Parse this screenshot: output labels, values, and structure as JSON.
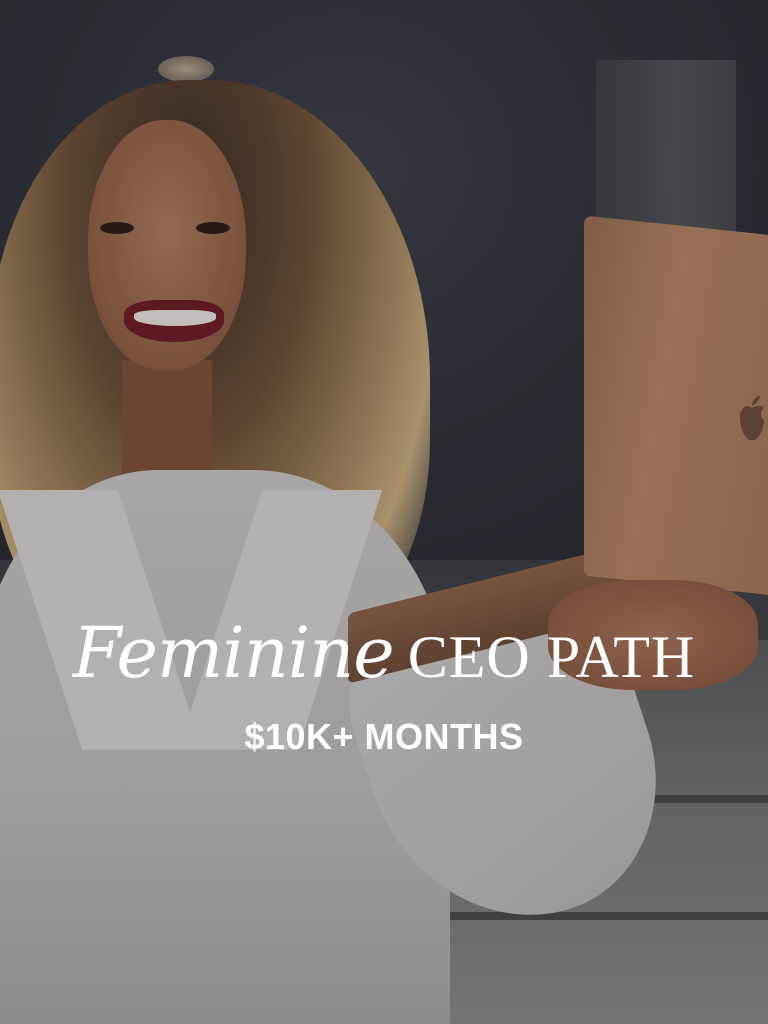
{
  "hero": {
    "title_script": "Feminine",
    "title_main": "CEO PATH",
    "subtitle": "$10K+ MONTHS"
  },
  "icons": {
    "laptop_logo": "apple-logo-icon"
  },
  "colors": {
    "text": "#ffffff",
    "laptop": "#b48463",
    "blazer": "#c9c7c4",
    "background": "#2c3036"
  }
}
